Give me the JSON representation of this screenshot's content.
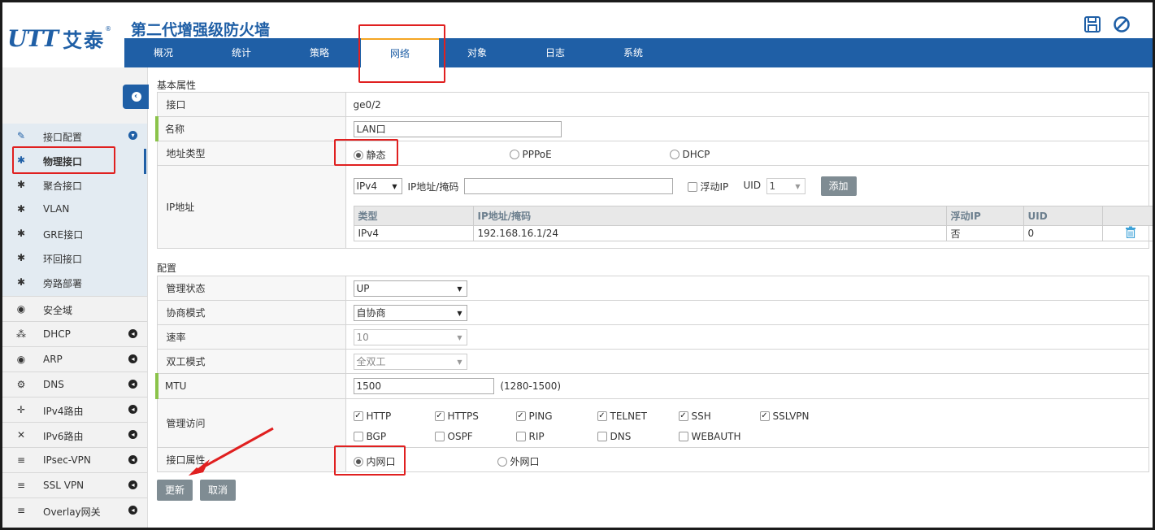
{
  "app": {
    "logo_mark": "UTT",
    "logo_cn": "艾泰",
    "logo_reg": "®",
    "title": "第二代增强级防火墙"
  },
  "nav": {
    "tabs": [
      {
        "label": "概况"
      },
      {
        "label": "统计"
      },
      {
        "label": "策略"
      },
      {
        "label": "网络",
        "active": true
      },
      {
        "label": "对象"
      },
      {
        "label": "日志"
      },
      {
        "label": "系统"
      }
    ]
  },
  "sidebar": {
    "collapse_glyph": "‹",
    "items": [
      {
        "label": "接口配置",
        "icon": "plug-icon",
        "expanded": true
      },
      {
        "label": "物理接口",
        "icon": "gear-icon",
        "selected": true
      },
      {
        "label": "聚合接口",
        "icon": "gear-icon"
      },
      {
        "label": "VLAN",
        "icon": "gear-icon"
      },
      {
        "label": "GRE接口",
        "icon": "gear-icon"
      },
      {
        "label": "环回接口",
        "icon": "gear-icon"
      },
      {
        "label": "旁路部署",
        "icon": "gear-icon"
      },
      {
        "label": "安全域",
        "icon": "globe-icon"
      },
      {
        "label": "DHCP",
        "icon": "network-icon"
      },
      {
        "label": "ARP",
        "icon": "globe-icon"
      },
      {
        "label": "DNS",
        "icon": "cogs-icon"
      },
      {
        "label": "IPv4路由",
        "icon": "arrows-icon"
      },
      {
        "label": "IPv6路由",
        "icon": "cross-arrows-icon"
      },
      {
        "label": "IPsec-VPN",
        "icon": "list-icon"
      },
      {
        "label": "SSL VPN",
        "icon": "list-icon"
      },
      {
        "label": "Overlay网关",
        "icon": "list-icon"
      }
    ]
  },
  "basic": {
    "section_title": "基本属性",
    "interface_label": "接口",
    "interface_value": "ge0/2",
    "name_label": "名称",
    "name_value": "LAN口",
    "addr_type_label": "地址类型",
    "addr_type_options": [
      "静态",
      "PPPoE",
      "DHCP"
    ],
    "addr_type_selected": "静态",
    "ip_label": "IP地址",
    "ip_version": "IPv4",
    "ip_mask_label": "IP地址/掩码",
    "ip_mask_value": "",
    "float_ip_label": "浮动IP",
    "uid_label": "UID",
    "uid_value": "1",
    "add_button": "添加",
    "ip_table": {
      "headers": [
        "类型",
        "IP地址/掩码",
        "浮动IP",
        "UID",
        ""
      ],
      "rows": [
        {
          "type": "IPv4",
          "ip": "192.168.16.1/24",
          "float": "否",
          "uid": "0"
        }
      ]
    }
  },
  "config": {
    "section_title": "配置",
    "admin_state_label": "管理状态",
    "admin_state_value": "UP",
    "nego_label": "协商模式",
    "nego_value": "自协商",
    "rate_label": "速率",
    "rate_value": "10",
    "duplex_label": "双工模式",
    "duplex_value": "全双工",
    "mtu_label": "MTU",
    "mtu_value": "1500",
    "mtu_hint": "(1280-1500)",
    "mgmt_label": "管理访问",
    "mgmt_options": [
      {
        "label": "HTTP",
        "checked": true
      },
      {
        "label": "HTTPS",
        "checked": true
      },
      {
        "label": "PING",
        "checked": true
      },
      {
        "label": "TELNET",
        "checked": true
      },
      {
        "label": "SSH",
        "checked": true
      },
      {
        "label": "SSLVPN",
        "checked": true
      },
      {
        "label": "BGP",
        "checked": false
      },
      {
        "label": "OSPF",
        "checked": false
      },
      {
        "label": "RIP",
        "checked": false
      },
      {
        "label": "DNS",
        "checked": false
      },
      {
        "label": "WEBAUTH",
        "checked": false
      }
    ],
    "if_attr_label": "接口属性",
    "if_attr_options": [
      "内网口",
      "外网口"
    ],
    "if_attr_selected": "内网口"
  },
  "actions": {
    "update": "更新",
    "cancel": "取消"
  },
  "colors": {
    "brand": "#1f5fa6",
    "nav_active_accent": "#f5a623",
    "required_marker": "#8bc34a",
    "annotation": "#e02020"
  }
}
